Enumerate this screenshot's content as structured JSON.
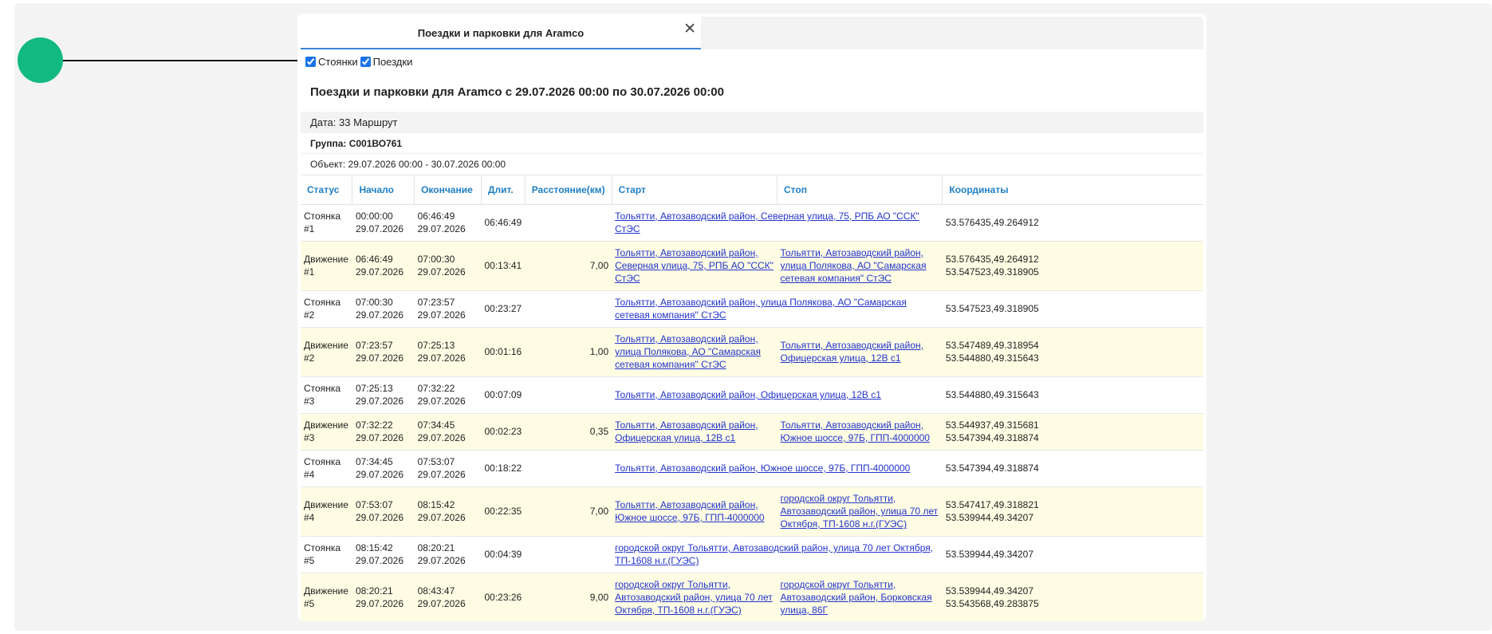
{
  "window": {
    "tab_title": "Поездки и парковки для Aramco",
    "close_glyph": "✕"
  },
  "filters": {
    "stops_label": "Стоянки",
    "stops_checked": true,
    "trips_label": "Поездки",
    "trips_checked": true
  },
  "report": {
    "title": "Поездки и парковки для Aramco с 29.07.2026 00:00 по 30.07.2026 00:00",
    "date_line": "Дата: 33 Маршрут",
    "group_line": "Группа: С001ВО761",
    "object_line": "Объект: 29.07.2026 00:00 - 30.07.2026 00:00"
  },
  "table": {
    "headers": [
      "Статус",
      "Начало",
      "Окончание",
      "Длит.",
      "Расстояние(км)",
      "Старт",
      "Стоп",
      "Координаты"
    ],
    "rows": [
      {
        "type": "stop",
        "status": "Стоянка #1",
        "start_time": "00:00:00",
        "start_date": "29.07.2026",
        "end_time": "06:46:49",
        "end_date": "29.07.2026",
        "duration": "06:46:49",
        "distance": "",
        "start_addr": "Тольятти, Автозаводский район, Северная улица, 75, РПБ АО \"ССК\" СтЭС",
        "stop_addr": "",
        "coord1": "53.576435,49.264912",
        "coord2": ""
      },
      {
        "type": "move",
        "status": "Движение #1",
        "start_time": "06:46:49",
        "start_date": "29.07.2026",
        "end_time": "07:00:30",
        "end_date": "29.07.2026",
        "duration": "00:13:41",
        "distance": "7,00",
        "start_addr": "Тольятти, Автозаводский район, Северная улица, 75, РПБ АО \"ССК\" СтЭС",
        "stop_addr": "Тольятти, Автозаводский район, улица Полякова, АО \"Самарская сетевая компания\" СтЭС",
        "coord1": "53.576435,49.264912",
        "coord2": "53.547523,49.318905"
      },
      {
        "type": "stop",
        "status": "Стоянка #2",
        "start_time": "07:00:30",
        "start_date": "29.07.2026",
        "end_time": "07:23:57",
        "end_date": "29.07.2026",
        "duration": "00:23:27",
        "distance": "",
        "start_addr": "Тольятти, Автозаводский район, улица Полякова, АО \"Самарская сетевая компания\" СтЭС",
        "stop_addr": "",
        "coord1": "53.547523,49.318905",
        "coord2": ""
      },
      {
        "type": "move",
        "status": "Движение #2",
        "start_time": "07:23:57",
        "start_date": "29.07.2026",
        "end_time": "07:25:13",
        "end_date": "29.07.2026",
        "duration": "00:01:16",
        "distance": "1,00",
        "start_addr": "Тольятти, Автозаводский район, улица Полякова, АО \"Самарская сетевая компания\" СтЭС",
        "stop_addr": "Тольятти, Автозаводский район, Офицерская улица, 12В с1",
        "coord1": "53.547489,49.318954",
        "coord2": "53.544880,49.315643"
      },
      {
        "type": "stop",
        "status": "Стоянка #3",
        "start_time": "07:25:13",
        "start_date": "29.07.2026",
        "end_time": "07:32:22",
        "end_date": "29.07.2026",
        "duration": "00:07:09",
        "distance": "",
        "start_addr": "Тольятти, Автозаводский район, Офицерская улица, 12В с1",
        "stop_addr": "",
        "coord1": "53.544880,49.315643",
        "coord2": ""
      },
      {
        "type": "move short",
        "status": "Движение #3",
        "start_time": "07:32:22",
        "start_date": "29.07.2026",
        "end_time": "07:34:45",
        "end_date": "29.07.2026",
        "duration": "00:02:23",
        "distance": "0,35",
        "start_addr": "Тольятти, Автозаводский район, Офицерская улица, 12В с1",
        "stop_addr": "Тольятти, Автозаводский район, Южное шоссе, 97Б, ГПП-4000000",
        "coord1": "53.544937,49.315681",
        "coord2": "53.547394,49.318874"
      },
      {
        "type": "stop",
        "status": "Стоянка #4",
        "start_time": "07:34:45",
        "start_date": "29.07.2026",
        "end_time": "07:53:07",
        "end_date": "29.07.2026",
        "duration": "00:18:22",
        "distance": "",
        "start_addr": "Тольятти, Автозаводский район, Южное шоссе, 97Б, ГПП-4000000",
        "stop_addr": "",
        "coord1": "53.547394,49.318874",
        "coord2": ""
      },
      {
        "type": "move",
        "status": "Движение #4",
        "start_time": "07:53:07",
        "start_date": "29.07.2026",
        "end_time": "08:15:42",
        "end_date": "29.07.2026",
        "duration": "00:22:35",
        "distance": "7,00",
        "start_addr": "Тольятти, Автозаводский район, Южное шоссе, 97Б, ГПП-4000000",
        "stop_addr": "городской округ Тольятти, Автозаводский район, улица 70 лет Октября, ТП-1608 н.г.(ГУЭС)",
        "coord1": "53.547417,49.318821",
        "coord2": "53.539944,49.34207"
      },
      {
        "type": "stop",
        "status": "Стоянка #5",
        "start_time": "08:15:42",
        "start_date": "29.07.2026",
        "end_time": "08:20:21",
        "end_date": "29.07.2026",
        "duration": "00:04:39",
        "distance": "",
        "start_addr": "городской округ Тольятти, Автозаводский район, улица 70 лет Октября, ТП-1608 н.г.(ГУЭС)",
        "stop_addr": "",
        "coord1": "53.539944,49.34207",
        "coord2": ""
      },
      {
        "type": "move",
        "status": "Движение #5",
        "start_time": "08:20:21",
        "start_date": "29.07.2026",
        "end_time": "08:43:47",
        "end_date": "29.07.2026",
        "duration": "00:23:26",
        "distance": "9,00",
        "start_addr": "городской округ Тольятти, Автозаводский район, улица 70 лет Октября, ТП-1608 н.г.(ГУЭС)",
        "stop_addr": "городской округ Тольятти, Автозаводский район, Борковская улица, 86Г",
        "coord1": "53.539944,49.34207",
        "coord2": "53.543568,49.283875"
      }
    ]
  },
  "colors": {
    "marker": "#12b980",
    "header_text": "#1f7fc4",
    "link": "#2233cc",
    "move_row_bg": "#fefde4",
    "tab_underline": "#3a86d4"
  }
}
